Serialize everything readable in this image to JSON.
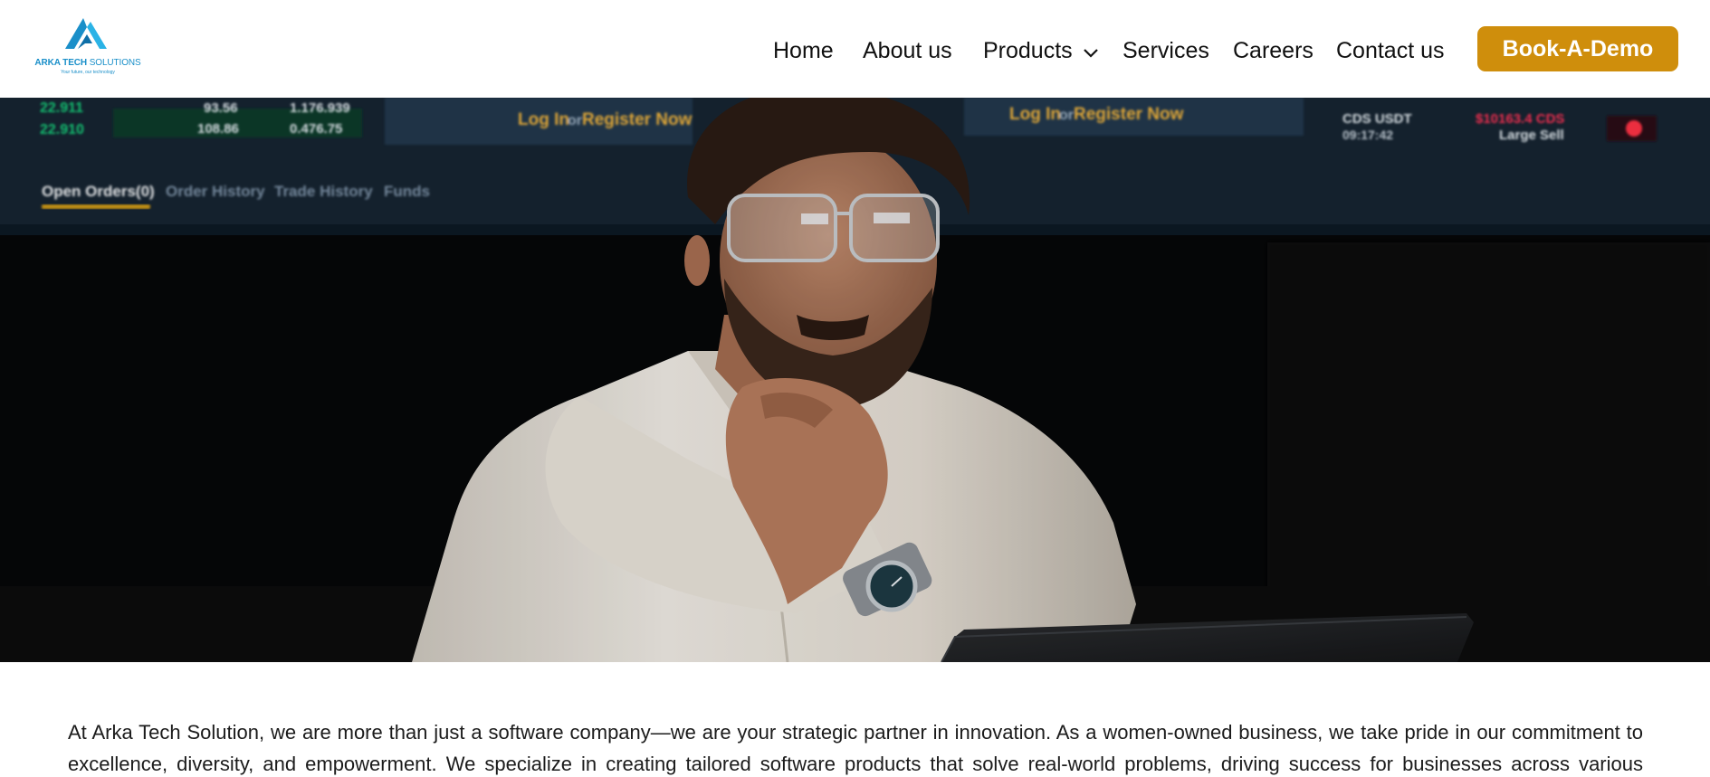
{
  "header": {
    "logo": {
      "name_bold": "ARKA TECH",
      "name_light": " SOLUTIONS",
      "tagline": "Your future, our technology",
      "icon": "arka-triangle-logo-icon"
    },
    "nav": [
      {
        "label": "Home"
      },
      {
        "label": "About us"
      },
      {
        "label": "Products",
        "icon": "chevron-down-icon"
      },
      {
        "label": "Services"
      },
      {
        "label": "Careers"
      },
      {
        "label": "Contact us"
      }
    ],
    "cta_label": "Book-A-Demo"
  },
  "hero": {
    "screen_tabs": [
      "Open Orders(0)",
      "Order History",
      "Trade History",
      "Funds"
    ],
    "screen_login": "Log In",
    "screen_or": "or",
    "screen_register": "Register Now",
    "screen_numbers_left": [
      "22.911",
      "22.910"
    ],
    "screen_mid_numbers": [
      "93.56",
      "108.86"
    ],
    "screen_mid_numbers2": [
      "1.176.939",
      "0.476.75"
    ],
    "screen_right_text": [
      "CDS USDT",
      "09:17:42",
      "Large Sell"
    ],
    "screen_right_red": "$10163.4 CDS"
  },
  "intro": {
    "text": "At Arka Tech Solution, we are more than just a software company—we are your strategic partner in innovation. As a women-owned business, we take pride in our commitment to excellence, diversity, and empowerment. We specialize in creating tailored software products that solve real-world problems, driving success for businesses across various"
  },
  "colors": {
    "accent": "#cf8e0c",
    "brand_blue": "#1a8fc9",
    "text": "#111111"
  }
}
